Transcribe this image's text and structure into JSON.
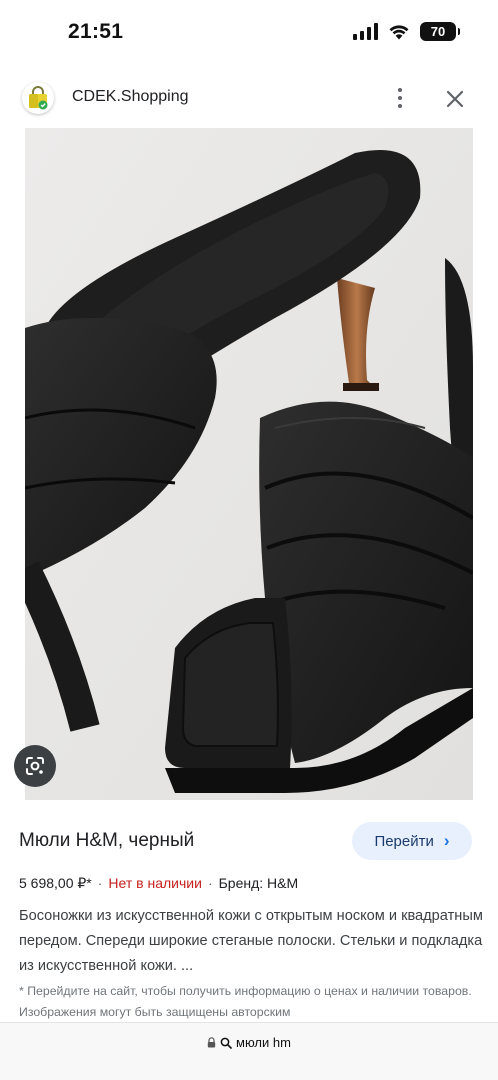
{
  "status_bar": {
    "time": "21:51",
    "battery": "70",
    "icons": [
      "signal-icon",
      "wifi-icon",
      "battery-icon"
    ]
  },
  "header": {
    "title": "CDEK.Shopping",
    "icons": [
      "cdek-shopping-logo-icon",
      "more-vert-icon",
      "close-icon"
    ]
  },
  "image": {
    "subject": "black quilted mule sandal",
    "lens_icon": "google-lens-icon"
  },
  "product": {
    "title": "Мюли H&M, черный",
    "button_label": "Перейти",
    "button_icon": "chevron-right-icon",
    "price": "5 698,00 ₽*",
    "separator": "·",
    "stock_status": "Нет в наличии",
    "brand": "Бренд: H&M",
    "description": "Босоножки из искусственной кожи с открытым носком и квадратным передом. Спереди широкие стеганые полоски. Стельки и подкладка из искусственной кожи. ...",
    "disclaimer": "* Перейдите на сайт, чтобы получить информацию о ценах и наличии товаров. Изображения могут быть защищены авторским"
  },
  "url_bar": {
    "text": "мюли hm",
    "icons": [
      "lock-icon",
      "search-icon"
    ]
  },
  "colors": {
    "accent_blue": "#1a73e8",
    "button_bg": "#e8f0fe",
    "stock_red": "#c5221f",
    "text_primary": "#202124",
    "text_secondary": "#70757a"
  }
}
